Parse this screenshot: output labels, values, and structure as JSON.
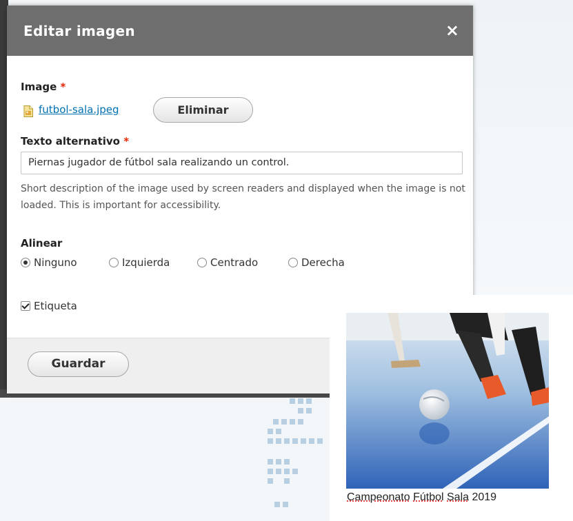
{
  "dialog": {
    "title": "Editar imagen",
    "close_symbol": "×",
    "image_label": "Image",
    "required_mark": "*",
    "file_name": "futbol-sala.jpeg",
    "remove_label": "Eliminar",
    "alt_label": "Texto alternativo",
    "alt_value": "Piernas jugador de fútbol sala realizando un control.",
    "alt_description": "Short description of the image used by screen readers and displayed when the image is not loaded. This is important for accessibility.",
    "align_label": "Alinear",
    "align_options": [
      "Ninguno",
      "Izquierda",
      "Centrado",
      "Derecha"
    ],
    "align_selected": "Ninguno",
    "caption_checkbox_label": "Etiqueta",
    "caption_checked": true,
    "save_label": "Guardar"
  },
  "preview": {
    "caption_words": [
      "Campeonato",
      "Fútbol",
      "Sala",
      "2019"
    ]
  },
  "icons": {
    "close": "close-icon",
    "file": "image-file-icon"
  },
  "colors": {
    "titlebar": "#6e6e6e",
    "required": "#e32700",
    "link": "#0071b3"
  }
}
